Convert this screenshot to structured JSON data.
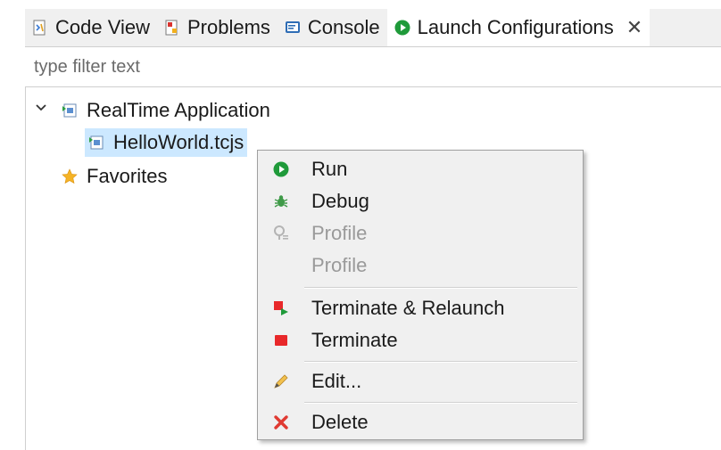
{
  "tabs": [
    {
      "label": "Code View",
      "icon": "code-view-icon"
    },
    {
      "label": "Problems",
      "icon": "problems-icon"
    },
    {
      "label": "Console",
      "icon": "console-icon"
    },
    {
      "label": "Launch Configurations",
      "icon": "launch-configurations-icon",
      "active": true
    }
  ],
  "close_label": "✕",
  "filter": {
    "placeholder": "type filter text",
    "value": ""
  },
  "tree": {
    "root_label": "RealTime Application",
    "child_label": "HelloWorld.tcjs",
    "favorites_label": "Favorites"
  },
  "menu": {
    "run": "Run",
    "debug": "Debug",
    "profile_1": "Profile",
    "profile_2": "Profile",
    "terminate_relaunch": "Terminate & Relaunch",
    "terminate": "Terminate",
    "edit": "Edit...",
    "delete": "Delete"
  },
  "colors": {
    "accent_green": "#1f9a3a",
    "selection": "#cce8ff",
    "terminate_red": "#e8282a",
    "menu_bg": "#f0f0f0"
  }
}
